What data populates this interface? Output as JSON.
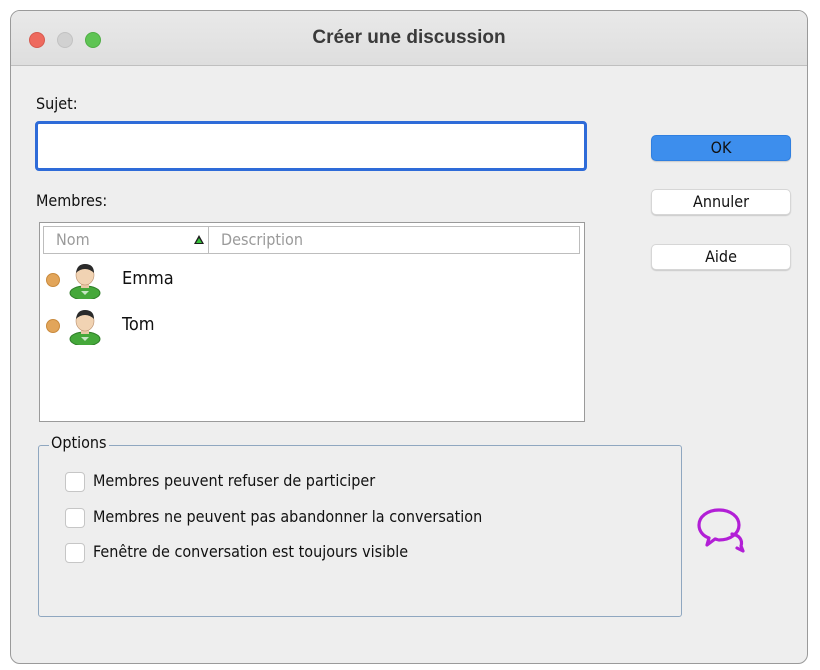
{
  "window": {
    "title": "Créer une discussion"
  },
  "form": {
    "subject_label": "Sujet:",
    "subject_value": "",
    "members_label": "Membres:"
  },
  "buttons": {
    "ok": "OK",
    "cancel": "Annuler",
    "help": "Aide"
  },
  "members_table": {
    "columns": [
      "Nom",
      "Description"
    ],
    "sort_column": "Nom",
    "sort_direction": "ascending",
    "rows": [
      {
        "name": "Emma",
        "description": "",
        "status_color": "#e2a55a",
        "icon": "user-avatar-icon"
      },
      {
        "name": "Tom",
        "description": "",
        "status_color": "#e2a55a",
        "icon": "user-avatar-icon"
      }
    ]
  },
  "options": {
    "legend": "Options",
    "items": [
      {
        "label": "Membres peuvent refuser de participer",
        "checked": false
      },
      {
        "label": "Membres ne peuvent pas abandonner la conversation",
        "checked": false
      },
      {
        "label": "Fenêtre de conversation est toujours visible",
        "checked": false
      }
    ]
  },
  "icons": {
    "chat": "chat-bubbles-icon"
  },
  "colors": {
    "accent": "#3d8eed",
    "focus_ring": "#2e6bd8",
    "chat_icon": "#b21fd6",
    "status_dot": "#e2a55a"
  }
}
